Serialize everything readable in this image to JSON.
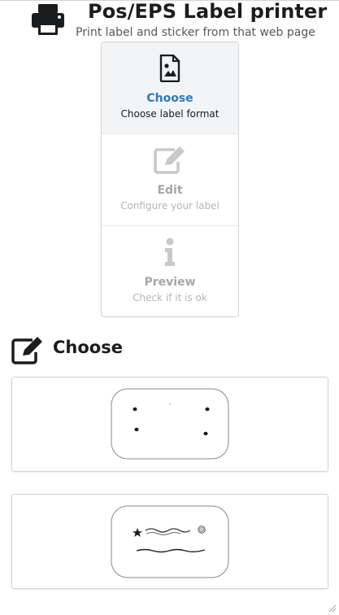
{
  "header": {
    "title": "Pos/EPS Label printer",
    "subtitle": "Print label and sticker from that web page",
    "icon": "printer-icon"
  },
  "steps": [
    {
      "title": "Choose",
      "description": "Choose label format",
      "icon": "image-file-icon",
      "state": "active"
    },
    {
      "title": "Edit",
      "description": "Configure your label",
      "icon": "edit-icon",
      "state": "disabled"
    },
    {
      "title": "Preview",
      "description": "Check if it is ok",
      "icon": "info-icon",
      "state": "disabled"
    }
  ],
  "section": {
    "title": "Choose",
    "icon": "edit-icon"
  },
  "label_formats": [
    {
      "name": "label-format-dots"
    },
    {
      "name": "label-format-lines"
    }
  ],
  "colors": {
    "active_step_title": "#2e78b8",
    "active_step_bg": "#f3f4f5",
    "disabled_text": "#a6a6a6",
    "border": "#d4d4d5"
  }
}
